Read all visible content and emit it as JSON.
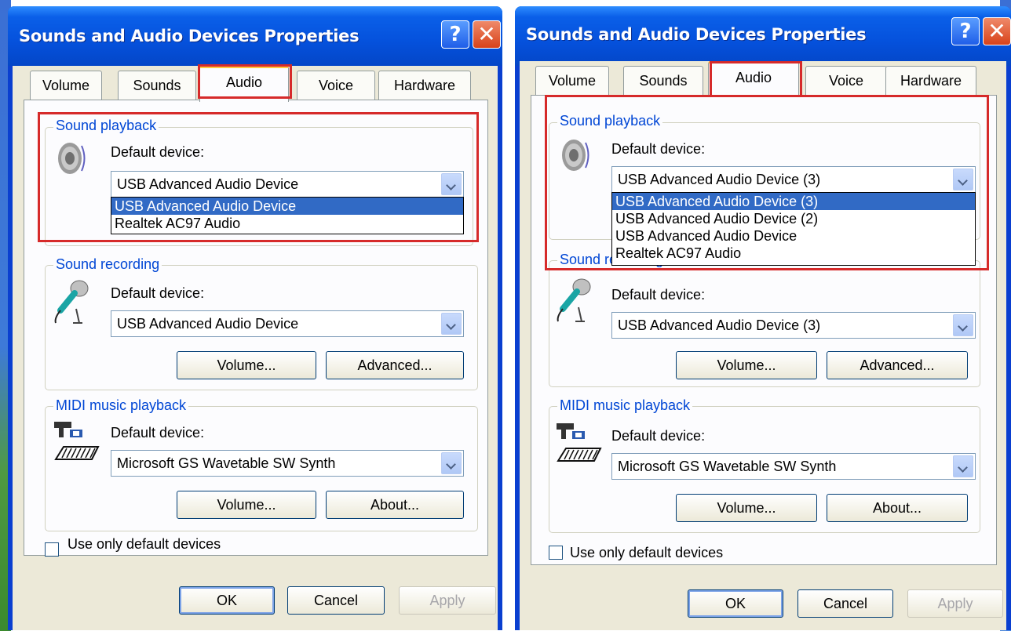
{
  "left": {
    "title": "Sounds and Audio Devices Properties",
    "help_glyph": "?",
    "close_glyph": "✕",
    "tabs": [
      "Volume",
      "Sounds",
      "Audio",
      "Voice",
      "Hardware"
    ],
    "active_tab": "Audio",
    "playback": {
      "label": "Sound playback",
      "default_label": "Default device:",
      "value": "USB Advanced Audio Device",
      "options": [
        "USB Advanced Audio Device",
        "Realtek AC97 Audio"
      ],
      "selected_option": "USB Advanced Audio Device"
    },
    "recording": {
      "label": "Sound recording",
      "default_label": "Default device:",
      "value": "USB Advanced Audio Device",
      "volume_btn": "Volume...",
      "advanced_btn": "Advanced..."
    },
    "midi": {
      "label": "MIDI music playback",
      "default_label": "Default device:",
      "value": "Microsoft GS Wavetable SW Synth",
      "volume_btn": "Volume...",
      "about_btn": "About..."
    },
    "use_default_label": "Use only default devices",
    "ok": "OK",
    "cancel": "Cancel",
    "apply": "Apply"
  },
  "right": {
    "title": "Sounds and Audio Devices Properties",
    "help_glyph": "?",
    "close_glyph": "✕",
    "tabs": [
      "Volume",
      "Sounds",
      "Audio",
      "Voice",
      "Hardware"
    ],
    "active_tab": "Audio",
    "playback": {
      "label": "Sound playback",
      "default_label": "Default device:",
      "value": "USB Advanced Audio Device (3)",
      "options": [
        "USB Advanced Audio Device (3)",
        "USB Advanced Audio Device (2)",
        "USB Advanced Audio Device",
        "Realtek AC97 Audio"
      ],
      "selected_option": "USB Advanced Audio Device (3)"
    },
    "recording": {
      "label": "Sound recording",
      "default_label": "Default device:",
      "value": "USB Advanced Audio Device (3)",
      "volume_btn": "Volume...",
      "advanced_btn": "Advanced..."
    },
    "midi": {
      "label": "MIDI music playback",
      "default_label": "Default device:",
      "value": "Microsoft GS Wavetable SW Synth",
      "volume_btn": "Volume...",
      "about_btn": "About..."
    },
    "use_default_label": "Use only default devices",
    "ok": "OK",
    "cancel": "Cancel",
    "apply": "Apply"
  },
  "colors": {
    "highlight": "#d62a2a",
    "title_bar": "#0551dc",
    "group_label": "#0046d5",
    "selection": "#316ac5"
  }
}
